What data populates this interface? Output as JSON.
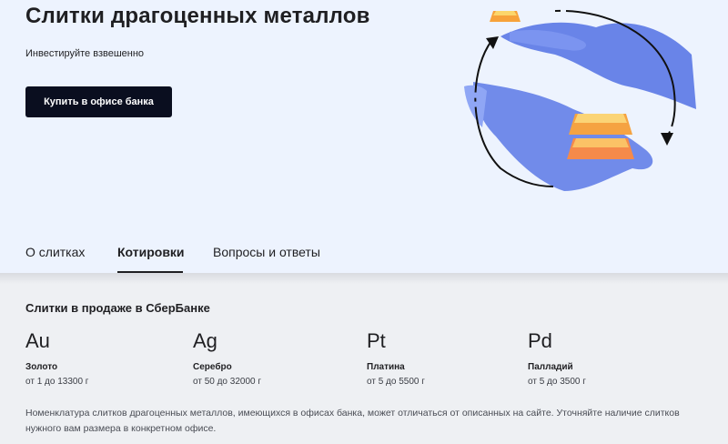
{
  "hero": {
    "title": "Слитки драгоценных металлов",
    "subtitle": "Инвестируйте взвешенно",
    "button_label": "Купить в офисе банка"
  },
  "tabs": [
    {
      "label": "О слитках",
      "active": false
    },
    {
      "label": "Котировки",
      "active": true
    },
    {
      "label": "Вопросы и ответы",
      "active": false
    }
  ],
  "section": {
    "title": "Слитки в продаже в СберБанке"
  },
  "metals": [
    {
      "symbol": "Au",
      "name": "Золото",
      "range": "от 1 до 13300 г"
    },
    {
      "symbol": "Ag",
      "name": "Серебро",
      "range": "от 50 до 32000 г"
    },
    {
      "symbol": "Pt",
      "name": "Платина",
      "range": "от 5 до 5500 г"
    },
    {
      "symbol": "Pd",
      "name": "Палладий",
      "range": "от 5 до 3500 г"
    }
  ],
  "note": "Номенклатура слитков драгоценных металлов, имеющихся в офисах банка, может отличаться от описанных на сайте. Уточняйте наличие слитков нужного вам размера в конкретном офисе.",
  "colors": {
    "hero_bg": "#edf3fe",
    "button_bg": "#0a0e1f",
    "hand_blue": "#5a78e6",
    "gold_orange": "#f7a23a"
  }
}
